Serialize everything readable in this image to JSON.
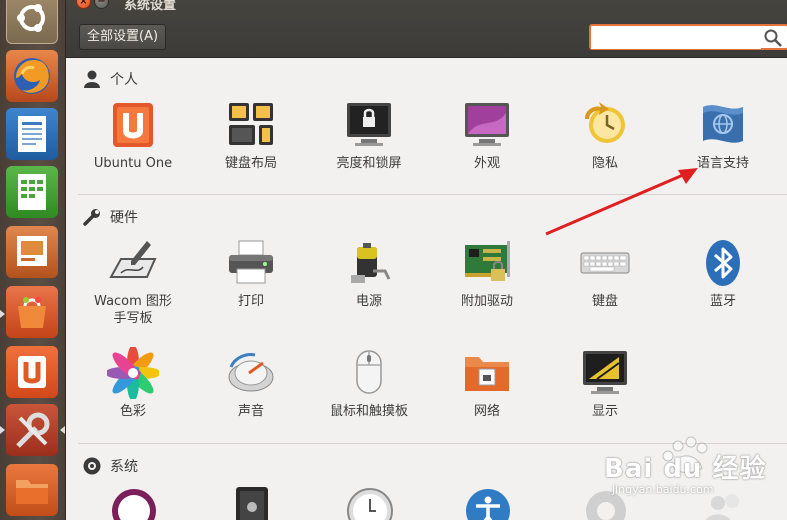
{
  "window": {
    "title": "系统设置",
    "all_settings_label": "全部设置(A)",
    "search_value": "",
    "search_placeholder": ""
  },
  "sections": [
    {
      "title": "个人",
      "items": [
        {
          "label": "Ubuntu One",
          "icon": "ubuntu-one-icon"
        },
        {
          "label": "键盘布局",
          "icon": "keyboard-layout-icon"
        },
        {
          "label": "亮度和锁屏",
          "icon": "brightness-lock-icon"
        },
        {
          "label": "外观",
          "icon": "appearance-icon"
        },
        {
          "label": "隐私",
          "icon": "privacy-icon"
        },
        {
          "label": "语言支持",
          "icon": "language-support-icon"
        }
      ]
    },
    {
      "title": "硬件",
      "items": [
        {
          "label": "Wacom 图形\n手写板",
          "icon": "wacom-tablet-icon"
        },
        {
          "label": "打印",
          "icon": "printer-icon"
        },
        {
          "label": "电源",
          "icon": "power-icon"
        },
        {
          "label": "附加驱动",
          "icon": "additional-drivers-icon"
        },
        {
          "label": "键盘",
          "icon": "keyboard-icon"
        },
        {
          "label": "蓝牙",
          "icon": "bluetooth-icon"
        },
        {
          "label": "色彩",
          "icon": "color-icon"
        },
        {
          "label": "声音",
          "icon": "sound-icon"
        },
        {
          "label": "鼠标和触摸板",
          "icon": "mouse-touchpad-icon"
        },
        {
          "label": "网络",
          "icon": "network-icon"
        },
        {
          "label": "显示",
          "icon": "display-icon"
        }
      ]
    },
    {
      "title": "系统",
      "items": []
    }
  ],
  "launcher": [
    "ubuntu-dash-icon",
    "firefox-icon",
    "writer-icon",
    "calc-icon",
    "impress-icon",
    "software-center-icon",
    "ubuntu-one-launcher-icon",
    "system-settings-icon",
    "files-icon"
  ],
  "watermark": {
    "text": "Bai du 经验",
    "sub": "jingyan.baidu.com"
  },
  "colors": {
    "accent": "#e3723c",
    "launcher_bg": "#4f443c",
    "arrow": "#e02020"
  }
}
